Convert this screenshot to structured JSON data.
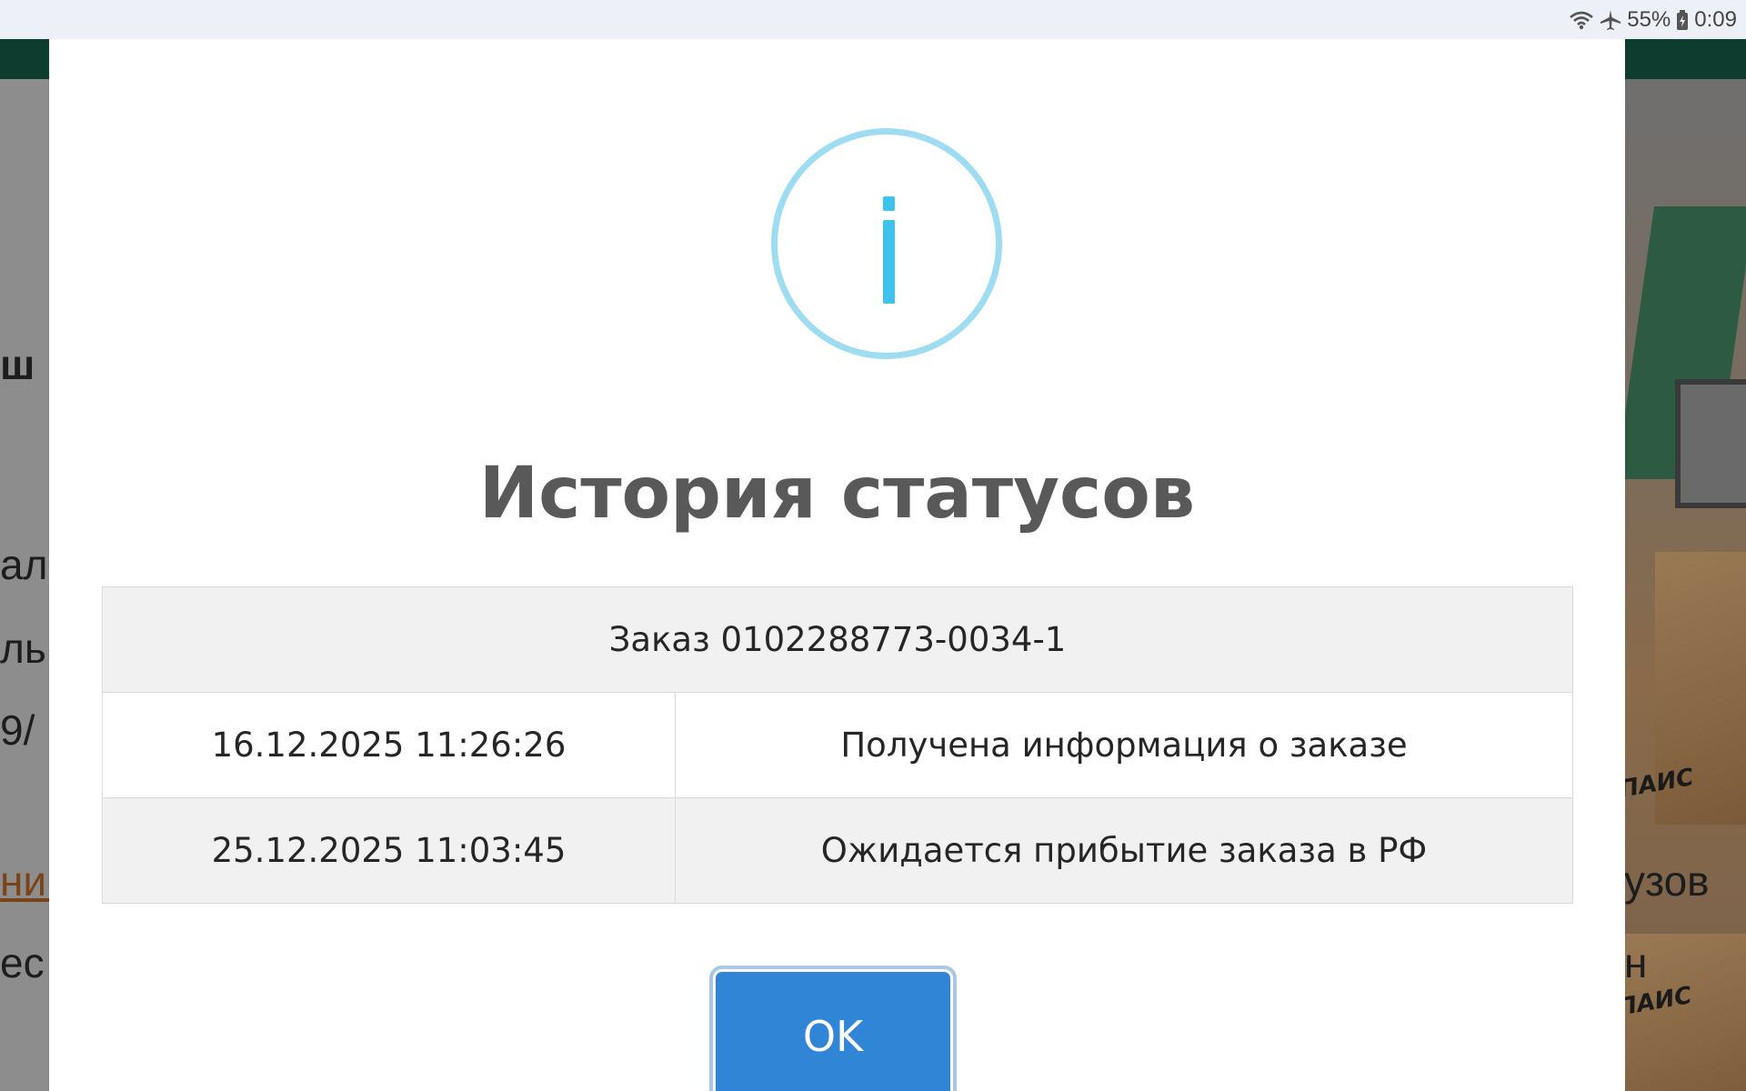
{
  "status_bar": {
    "battery": "55%",
    "time": "0:09",
    "icons": [
      "wifi-icon",
      "airplane-mode-icon",
      "battery-icon"
    ]
  },
  "background_page": {
    "fragments": [
      "ш",
      "ал",
      "льн",
      "9/",
      "ник",
      "ес",
      "узов",
      "н"
    ],
    "brand_logo": "ПАИС",
    "colors": {
      "header": "#0c3d2e",
      "link": "#7a4418"
    }
  },
  "modal": {
    "icon": "info-icon",
    "title": "История статусов",
    "order_label": "Заказ 0102288773-0034-1",
    "history": [
      {
        "datetime": "16.12.2025 11:26:26",
        "status": "Получена информация о заказе"
      },
      {
        "datetime": "25.12.2025 11:03:45",
        "status": "Ожидается прибытие заказа в РФ"
      }
    ],
    "ok_label": "OK",
    "colors": {
      "title": "#595959",
      "icon": "#3fc3ee",
      "icon_ring": "#9edcf1",
      "button": "#3085d6"
    }
  }
}
